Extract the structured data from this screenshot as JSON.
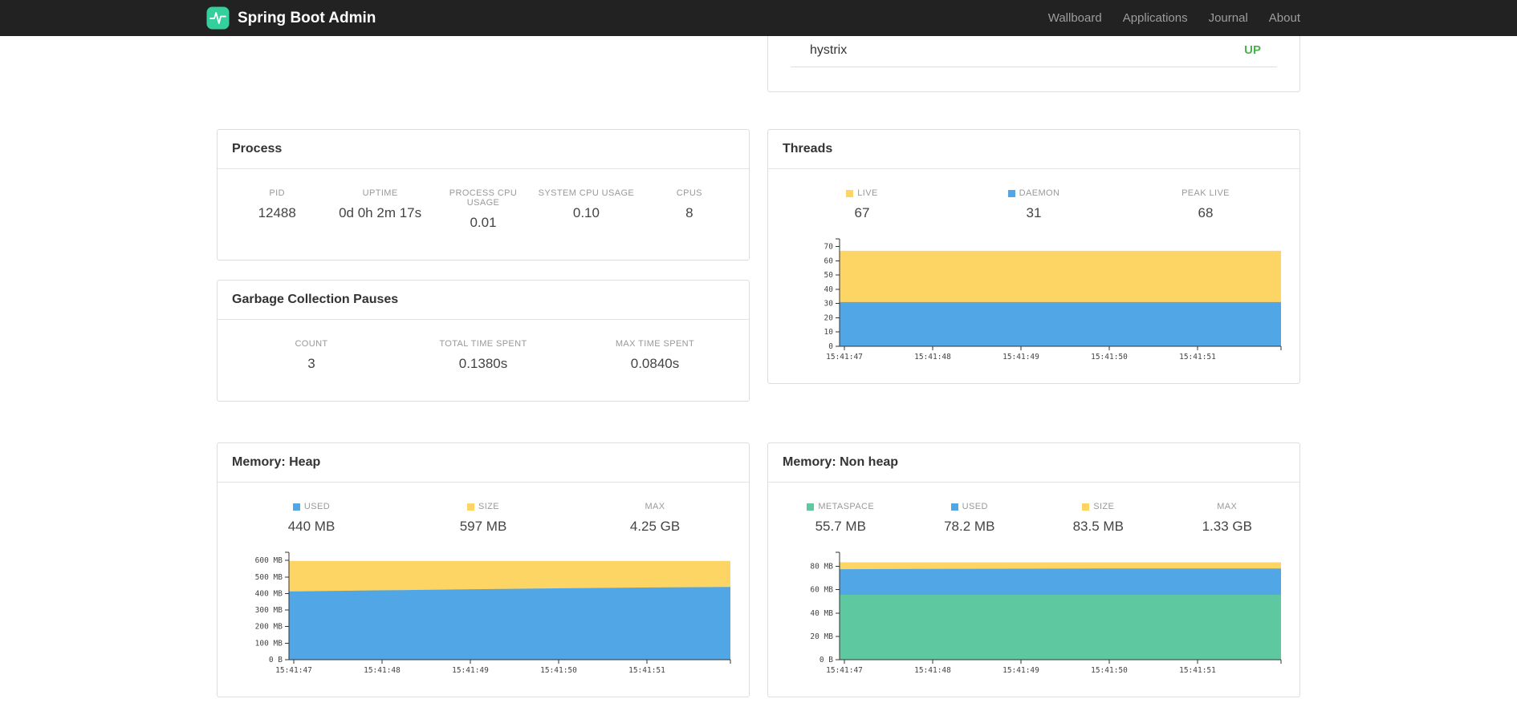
{
  "navbar": {
    "brand": "Spring Boot Admin",
    "items": [
      {
        "label": "Wallboard"
      },
      {
        "label": "Applications"
      },
      {
        "label": "Journal"
      },
      {
        "label": "About"
      }
    ]
  },
  "colors": {
    "brand_logo": "#35cf9e",
    "status_up": "#4caf50",
    "series_yellow": "#fdd565",
    "series_blue": "#51a7e6",
    "series_green": "#5ec9a1"
  },
  "status_card": {
    "application": "hystrix",
    "status": "UP"
  },
  "process": {
    "title": "Process",
    "metrics": [
      {
        "label": "PID",
        "value": "12488"
      },
      {
        "label": "UPTIME",
        "value": "0d 0h 2m 17s"
      },
      {
        "label": "PROCESS CPU USAGE",
        "value": "0.01"
      },
      {
        "label": "SYSTEM CPU USAGE",
        "value": "0.10"
      },
      {
        "label": "CPUS",
        "value": "8"
      }
    ]
  },
  "gc": {
    "title": "Garbage Collection Pauses",
    "metrics": [
      {
        "label": "COUNT",
        "value": "3"
      },
      {
        "label": "TOTAL TIME SPENT",
        "value": "0.1380s"
      },
      {
        "label": "MAX TIME SPENT",
        "value": "0.0840s"
      }
    ]
  },
  "threads": {
    "title": "Threads",
    "metrics": [
      {
        "label": "LIVE",
        "value": "67",
        "color": "#fdd565"
      },
      {
        "label": "DAEMON",
        "value": "31",
        "color": "#51a7e6"
      },
      {
        "label": "PEAK LIVE",
        "value": "68"
      }
    ],
    "chart": {
      "type": "area",
      "y_max": 72,
      "y_ticks": [
        {
          "v": 0,
          "label": "0"
        },
        {
          "v": 10,
          "label": "10"
        },
        {
          "v": 20,
          "label": "20"
        },
        {
          "v": 30,
          "label": "30"
        },
        {
          "v": 40,
          "label": "40"
        },
        {
          "v": 50,
          "label": "50"
        },
        {
          "v": 60,
          "label": "60"
        },
        {
          "v": 70,
          "label": "70"
        }
      ],
      "x_labels": [
        "15:41:47",
        "15:41:48",
        "15:41:49",
        "15:41:50",
        "15:41:51"
      ],
      "layers": [
        {
          "name": "live",
          "color": "#fdd565",
          "values": [
            67,
            67,
            67,
            67,
            67,
            67
          ]
        },
        {
          "name": "daemon",
          "color": "#51a7e6",
          "values": [
            31,
            31,
            31,
            31,
            31,
            31
          ]
        }
      ]
    }
  },
  "heap": {
    "title": "Memory: Heap",
    "metrics": [
      {
        "label": "USED",
        "value": "440 MB",
        "color": "#51a7e6"
      },
      {
        "label": "SIZE",
        "value": "597 MB",
        "color": "#fdd565"
      },
      {
        "label": "MAX",
        "value": "4.25 GB"
      }
    ],
    "chart": {
      "type": "area",
      "y_max": 620,
      "y_ticks": [
        {
          "v": 0,
          "label": "0 B"
        },
        {
          "v": 100,
          "label": "100 MB"
        },
        {
          "v": 200,
          "label": "200 MB"
        },
        {
          "v": 300,
          "label": "300 MB"
        },
        {
          "v": 400,
          "label": "400 MB"
        },
        {
          "v": 500,
          "label": "500 MB"
        },
        {
          "v": 600,
          "label": "600 MB"
        }
      ],
      "x_labels": [
        "15:41:47",
        "15:41:48",
        "15:41:49",
        "15:41:50",
        "15:41:51"
      ],
      "layers": [
        {
          "name": "size",
          "color": "#fdd565",
          "values": [
            597,
            597,
            597,
            597,
            597,
            597
          ]
        },
        {
          "name": "used",
          "color": "#51a7e6",
          "values": [
            412,
            419,
            425,
            431,
            436,
            440
          ]
        }
      ]
    }
  },
  "nonheap": {
    "title": "Memory: Non heap",
    "metrics": [
      {
        "label": "METASPACE",
        "value": "55.7 MB",
        "color": "#5ec9a1"
      },
      {
        "label": "USED",
        "value": "78.2 MB",
        "color": "#51a7e6"
      },
      {
        "label": "SIZE",
        "value": "83.5 MB",
        "color": "#fdd565"
      },
      {
        "label": "MAX",
        "value": "1.33 GB"
      }
    ],
    "chart": {
      "type": "area",
      "y_max": 88,
      "y_ticks": [
        {
          "v": 0,
          "label": "0 B"
        },
        {
          "v": 20,
          "label": "20 MB"
        },
        {
          "v": 40,
          "label": "40 MB"
        },
        {
          "v": 60,
          "label": "60 MB"
        },
        {
          "v": 80,
          "label": "80 MB"
        }
      ],
      "x_labels": [
        "15:41:47",
        "15:41:48",
        "15:41:49",
        "15:41:50",
        "15:41:51"
      ],
      "layers": [
        {
          "name": "size",
          "color": "#fdd565",
          "values": [
            83.5,
            83.5,
            83.5,
            83.5,
            83.5,
            83.5
          ]
        },
        {
          "name": "used",
          "color": "#51a7e6",
          "values": [
            77.6,
            77.9,
            78.0,
            78.2,
            78.2,
            78.2
          ]
        },
        {
          "name": "metaspace",
          "color": "#5ec9a1",
          "values": [
            55.7,
            55.7,
            55.7,
            55.7,
            55.7,
            55.7
          ]
        }
      ]
    }
  }
}
